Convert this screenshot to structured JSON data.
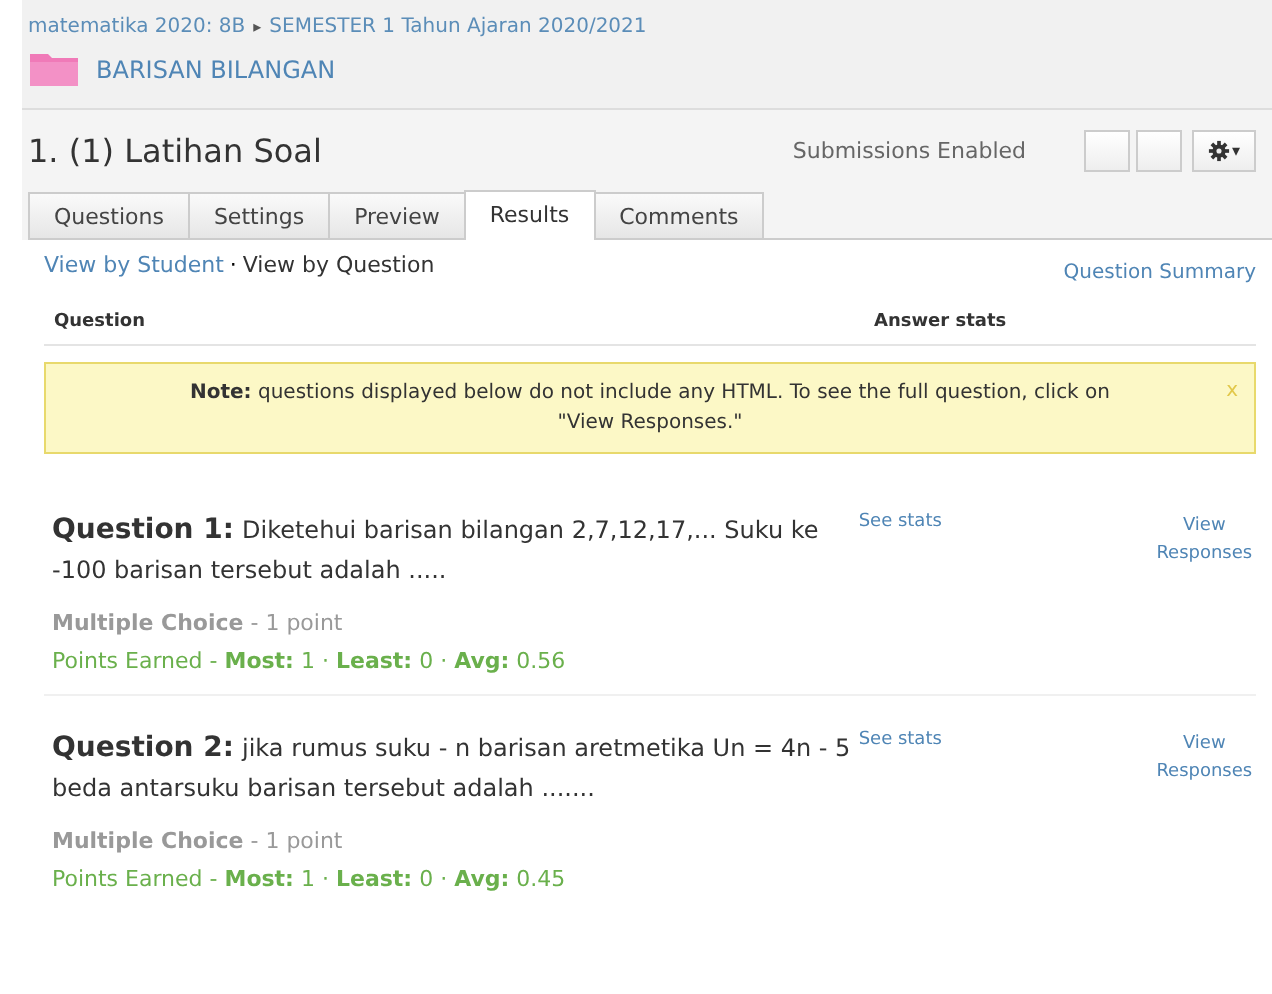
{
  "breadcrumb": {
    "items": [
      "matematika 2020: 8B",
      "SEMESTER 1 Tahun Ajaran 2020/2021"
    ],
    "separator": "▸",
    "folder": "BARISAN BILANGAN"
  },
  "header": {
    "title": "1. (1) Latihan Soal",
    "status": "Submissions Enabled",
    "caret": "▾"
  },
  "tabs": [
    {
      "label": "Questions",
      "selected": false
    },
    {
      "label": "Settings",
      "selected": false
    },
    {
      "label": "Preview",
      "selected": false
    },
    {
      "label": "Results",
      "selected": true
    },
    {
      "label": "Comments",
      "selected": false
    }
  ],
  "views": [
    {
      "label": "View by Student",
      "selected": false
    },
    {
      "label": "View by Question",
      "selected": true
    }
  ],
  "view_separator": "·",
  "summary_link": "Question Summary",
  "table": {
    "columns": [
      "Question",
      "Answer stats"
    ]
  },
  "note": {
    "text": "**Note:** questions displayed below do not include any HTML. To see the full question, click on \"View Responses.\"",
    "close": "x"
  },
  "questions": [
    {
      "label": "Question 1:",
      "text": "Diketehui barisan bilangan 2,7,12,17,... Suku ke -100 barisan tersebut adalah .....",
      "stats_link": "See stats",
      "responses_link": "View Responses",
      "type": "**Multiple Choice** - 1 point",
      "earned": "Points Earned - **Most:** 1 · **Least:** 0 · **Avg:** 0.56"
    },
    {
      "label": "Question 2:",
      "text": "jika rumus suku - n barisan aretmetika  Un = 4n - 5 beda antarsuku barisan tersebut adalah .......",
      "stats_link": "See stats",
      "responses_link": "View Responses",
      "type": "**Multiple Choice** - 1 point",
      "earned": "Points Earned - **Most:** 1 · **Least:** 0 · **Avg:** 0.45"
    }
  ]
}
